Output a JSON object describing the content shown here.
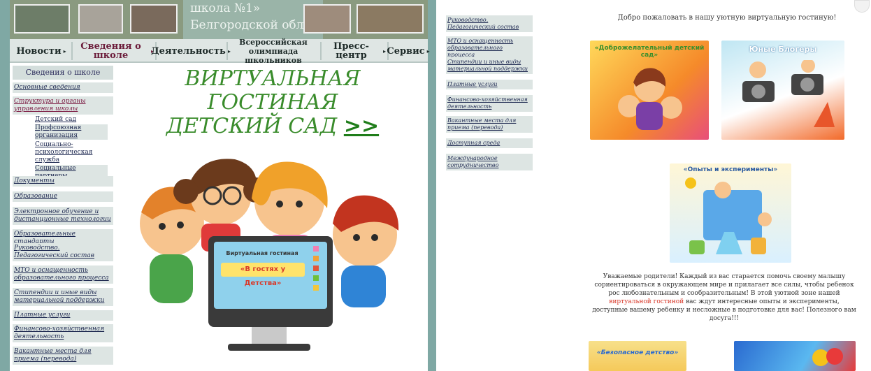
{
  "banner": {
    "line1": "школа №1»",
    "line2": "Белгородской области"
  },
  "nav": {
    "items": [
      {
        "label": "Новости",
        "arrow": "▸"
      },
      {
        "label": "Сведения о школе",
        "arrow": "▸"
      },
      {
        "label": "Деятельность",
        "arrow": "▸"
      },
      {
        "label": "Всероссийская олимпиада школьников",
        "arrow": ""
      },
      {
        "label": "Пресс-центр",
        "arrow": "▸"
      },
      {
        "label": "Сервис",
        "arrow": "▸"
      }
    ]
  },
  "sidebar": {
    "title": "Сведения о школе",
    "items": [
      "Основные сведения",
      "Структура и органы управления школы",
      "Документы",
      "Образование",
      "Электронное обучение и дистанционные технологии",
      "Образовательные стандарты",
      "Руководство. Педагогический состав",
      "МТО и оснащенность образовательного процесса",
      "Стипендии и иные виды материальной поддержки",
      "Платные услуги",
      "Финансово-хозяйственная деятельность",
      "Вакантные места для приема (перевода)"
    ],
    "subitems": [
      "Детский сад",
      "Профсоюзная организация",
      "Социально-психологическая служба",
      "Социальные партнеры"
    ]
  },
  "main": {
    "title_line1": "ВИРТУАЛЬНАЯ",
    "title_line2": "ГОСТИНАЯ",
    "title_line3": "ДЕТСКИЙ САД",
    "title_link": ">>",
    "screen_title": "Виртуальная гостиная",
    "screen_subtitle": "«В гостях у Детства»"
  },
  "panel2": {
    "sidebar_items": [
      "Руководство. Педагогический состав",
      "МТО и оснащенность образовательного процесса",
      "Стипендии и иные виды материальной поддержки",
      "Платные услуги",
      "Финансово-хозяйственная деятельность",
      "Вакантные места для приема (перевода)",
      "Доступная среда",
      "Международное сотрудничество"
    ],
    "welcome": "Добро пожаловать в нашу уютную виртуальную гостиную!",
    "tiles": [
      "«Доброжелательный детский сад»",
      "Юные Блогеры",
      "«Опыты и эксперименты»",
      "«Безопасное детство»"
    ],
    "para_part1": "Уважаемые родители! Каждый из вас старается помочь своему малышу сориентироваться в окружающем мире и прилагает все силы, чтобы ребенок рос любознательным и сообразительным! В этой уютной зоне нашей ",
    "para_highlight": "виртуальной гостиной",
    "para_part2": " вас ждут интересные опыты и эксперименты, доступные вашему ребенку и несложные в подготовке для вас! Полезного вам досуга!!!"
  },
  "colors": {
    "frame": "#7fa8a4",
    "title_green": "#3a8c2c",
    "link": "#1d2850",
    "highlight_red": "#d83a2b"
  }
}
